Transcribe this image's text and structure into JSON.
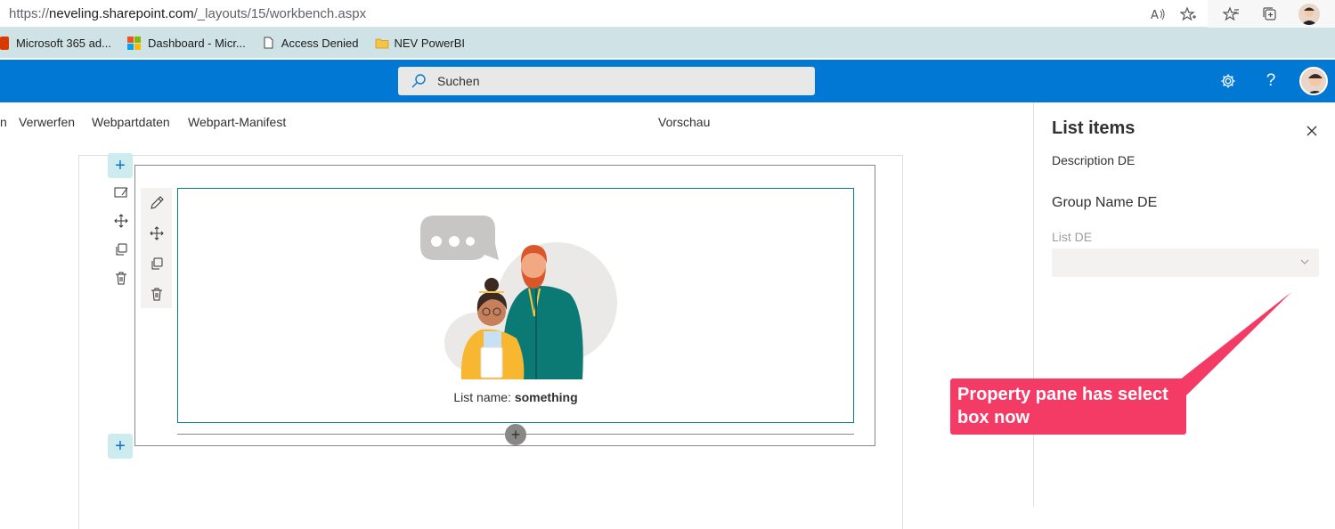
{
  "browser": {
    "url_prefix": "https://",
    "url_host": "neveling.sharepoint.com",
    "url_path": "/_layouts/15/workbench.aspx",
    "bookmarks": [
      {
        "label": "Microsoft 365 ad..."
      },
      {
        "label": "Dashboard - Micr..."
      },
      {
        "label": "Access Denied"
      },
      {
        "label": "NEV PowerBI"
      }
    ]
  },
  "suitebar": {
    "search_placeholder": "Suchen",
    "accent": "#0078d4"
  },
  "commandbar": {
    "items": [
      "n",
      "Verwerfen",
      "Webpartdaten",
      "Webpart-Manifest"
    ],
    "preview": "Vorschau"
  },
  "webpart": {
    "list_name_label": "List name:",
    "list_name_value": "something"
  },
  "property_pane": {
    "title": "List items",
    "description": "Description DE",
    "group_name": "Group Name DE",
    "list_label": "List DE",
    "list_value": ""
  },
  "annotation": {
    "text": "Property pane has select box now",
    "color": "#f43b66"
  }
}
